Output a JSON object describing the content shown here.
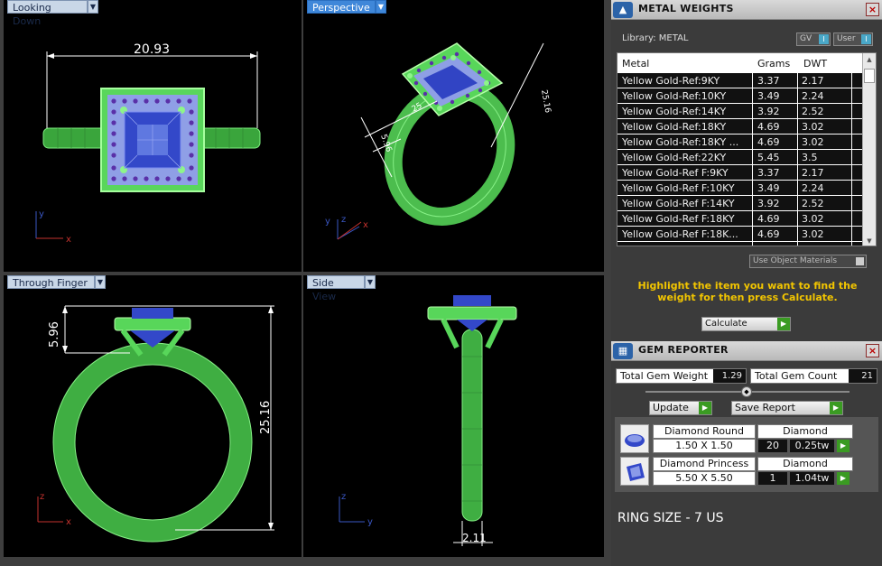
{
  "viewports": {
    "top_left": {
      "label": "Looking Down",
      "dimension": "20.93",
      "axis_v": "y",
      "axis_h": "x"
    },
    "top_right": {
      "label": "Perspective",
      "dim_a": "25.16",
      "dim_b": "5.96",
      "dim_c": "25",
      "axis_1": "y",
      "axis_2": "z",
      "axis_3": "x"
    },
    "bottom_left": {
      "label": "Through Finger",
      "dim_height": "5.96",
      "dim_total": "25.16",
      "axis_v": "z",
      "axis_h": "x"
    },
    "bottom_right": {
      "label": "Side View",
      "dim_width": "2.11",
      "axis_v": "z",
      "axis_h": "y"
    }
  },
  "metal_weights": {
    "title": "METAL WEIGHTS",
    "library": "Library: METAL",
    "gv_label": "GV",
    "gv_value": "I",
    "user_label": "User",
    "user_value": "I",
    "columns": [
      "Metal",
      "Grams",
      "DWT"
    ],
    "rows": [
      [
        "Yellow Gold-Ref:9KY",
        "3.37",
        "2.17"
      ],
      [
        "Yellow Gold-Ref:10KY",
        "3.49",
        "2.24"
      ],
      [
        "Yellow Gold-Ref:14KY",
        "3.92",
        "2.52"
      ],
      [
        "Yellow Gold-Ref:18KY",
        "4.69",
        "3.02"
      ],
      [
        "Yellow Gold-Ref:18KY ...",
        "4.69",
        "3.02"
      ],
      [
        "Yellow Gold-Ref:22KY",
        "5.45",
        "3.5"
      ],
      [
        "Yellow Gold-Ref F:9KY",
        "3.37",
        "2.17"
      ],
      [
        "Yellow Gold-Ref F:10KY",
        "3.49",
        "2.24"
      ],
      [
        "Yellow Gold-Ref F:14KY",
        "3.92",
        "2.52"
      ],
      [
        "Yellow Gold-Ref F:18KY",
        "4.69",
        "3.02"
      ],
      [
        "Yellow Gold-Ref F:18K...",
        "4.69",
        "3.02"
      ],
      [
        "Yellow Gold-Ref F:22KY",
        "5.45",
        "3.5"
      ]
    ],
    "use_object_materials": "Use Object Materials",
    "hint": "Highlight the item you want to find the weight for then press Calculate.",
    "calculate": "Calculate"
  },
  "gem_reporter": {
    "title": "GEM REPORTER",
    "total_weight_label": "Total Gem Weight",
    "total_weight_value": "1.29",
    "total_count_label": "Total Gem Count",
    "total_count_value": "21",
    "update": "Update",
    "save_report": "Save Report",
    "gems": [
      {
        "shape": "Diamond Round",
        "material": "Diamond",
        "size": "1.50 X 1.50",
        "count": "20",
        "weight": "0.25tw",
        "icon": "round-gem-icon"
      },
      {
        "shape": "Diamond Princess",
        "material": "Diamond",
        "size": "5.50 X 5.50",
        "count": "1",
        "weight": "1.04tw",
        "icon": "princess-gem-icon"
      }
    ],
    "ring_size": "RING SIZE - 7 US"
  },
  "colors": {
    "ring_green": "#58d95a",
    "gem_blue": "#3355cc",
    "hint_yellow": "#f2c500",
    "go_green": "#3a9b22"
  }
}
